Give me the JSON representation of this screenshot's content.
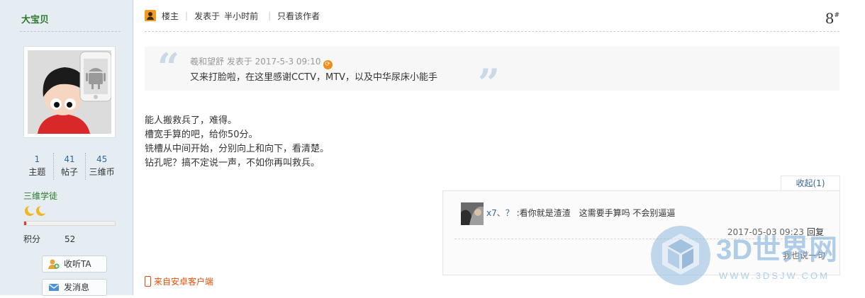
{
  "sidebar": {
    "username": "大宝贝",
    "stats": [
      {
        "value": "1",
        "label": "主题"
      },
      {
        "value": "41",
        "label": "帖子"
      },
      {
        "value": "45",
        "label": "三维币"
      }
    ],
    "rank": "三维学徒",
    "level_icons": [
      "moon-icon",
      "moon-icon"
    ],
    "level_progress": 0.02,
    "points_label": "积分",
    "points_value": "52",
    "follow_button": "收听TA",
    "message_button": "发消息"
  },
  "post": {
    "author_badge": "楼主",
    "posted_prefix": "发表于",
    "posted_time": "半小时前",
    "only_author": "只看该作者",
    "floor_number": "8",
    "floor_suffix": "#",
    "quote": {
      "header": "羲和望舒 发表于 2017-5-3 09:10",
      "body": "又来打脸啦，在这里感谢CCTV，MTV，以及中华尿床小能手"
    },
    "content_lines": [
      "能人搬救兵了，难得。",
      "槽宽手算的吧，给你50分。",
      "铣槽从中间开始，分别向上和向下，看清楚。",
      "钻孔呢？搞不定说一声，不如你再叫救兵。"
    ],
    "collapse_label": "收起(1)",
    "comment": {
      "user": "x7、？",
      "text": ":看你就是渣渣　这需要手算吗 不会别逼逼",
      "time": "2017-05-03 09:23",
      "reply_label": "回复",
      "more_label": "我也说一句"
    },
    "source": "来自安卓客户端"
  },
  "watermark": {
    "brand": "3D世界网",
    "url": "WWW.3DSJW.COM"
  },
  "colors": {
    "sidebar_bg": "#e5edf2",
    "link_blue": "#336699",
    "rank_green": "#2a7a2a",
    "source_orange": "#e04f07"
  }
}
